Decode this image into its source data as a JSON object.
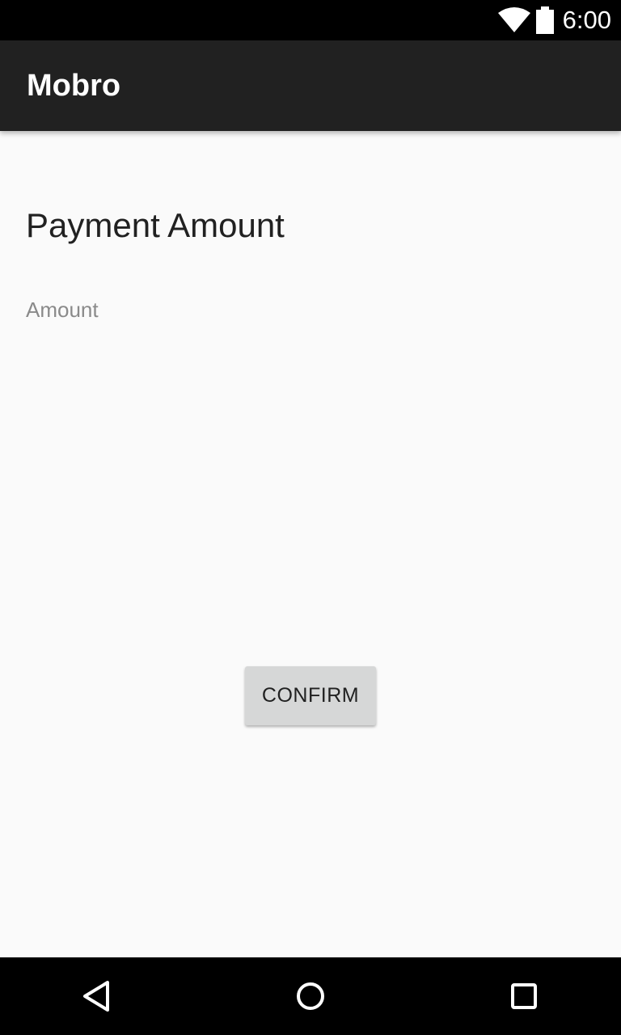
{
  "status_bar": {
    "time": "6:00",
    "icons": [
      "wifi-icon",
      "battery-icon"
    ]
  },
  "app_bar": {
    "title": "Mobro"
  },
  "main": {
    "title": "Payment Amount",
    "amount_field": {
      "value": "",
      "placeholder": "Amount"
    },
    "confirm_label": "CONFIRM"
  },
  "nav_bar": {
    "icons": [
      "back-icon",
      "home-icon",
      "recents-icon"
    ]
  },
  "colors": {
    "status_bar": "#000000",
    "app_bar": "#212121",
    "background": "#fafafa",
    "button": "#d6d7d7",
    "nav_bar": "#000000"
  }
}
